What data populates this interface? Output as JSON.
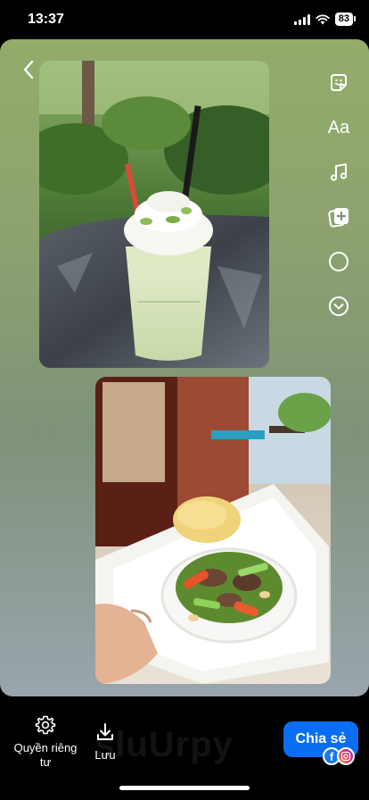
{
  "status_bar": {
    "time": "13:37",
    "battery": "83"
  },
  "watermark": "sluUrpy",
  "canvas": {
    "photos": [
      {
        "subject": "green-matcha-frappe"
      },
      {
        "subject": "beef-stir-fry-with-fried-rice"
      }
    ],
    "tools": [
      "sticker-icon",
      "text-tool",
      "music-icon",
      "add-media-icon",
      "circle-icon",
      "chevron-down-icon"
    ],
    "text_tool_label": "Aa"
  },
  "bottom_bar": {
    "privacy_label": "Quyền riêng tư",
    "save_label": "Lưu",
    "share_label": "Chia sẻ",
    "facebook_glyph": "f"
  },
  "colors": {
    "share_button": "#0a6ef5",
    "facebook": "#1877f2"
  }
}
